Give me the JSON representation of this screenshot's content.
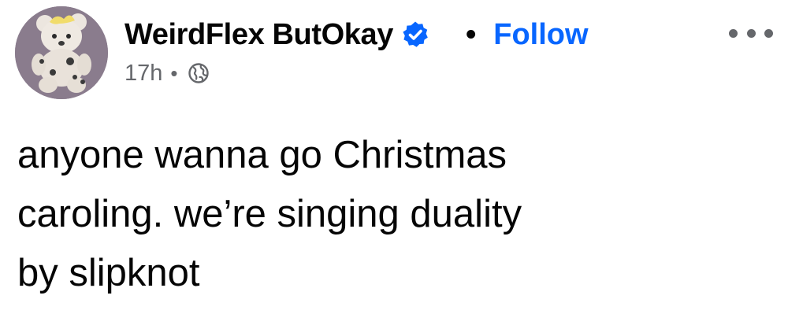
{
  "post": {
    "author": {
      "name": "WeirdFlex ButOkay",
      "verified": true,
      "avatar_icon": "teddy-bear-avatar"
    },
    "separator": "•",
    "follow_label": "Follow",
    "timestamp": "17h",
    "meta_separator": "•",
    "audience_icon": "globe-icon",
    "more_icon": "more-options-icon",
    "text_lines": [
      "anyone wanna go Christmas",
      "caroling. we’re singing duality",
      "by slipknot"
    ]
  },
  "colors": {
    "text": "#050505",
    "secondary": "#65676b",
    "link": "#0866ff",
    "badge": "#0866ff"
  }
}
